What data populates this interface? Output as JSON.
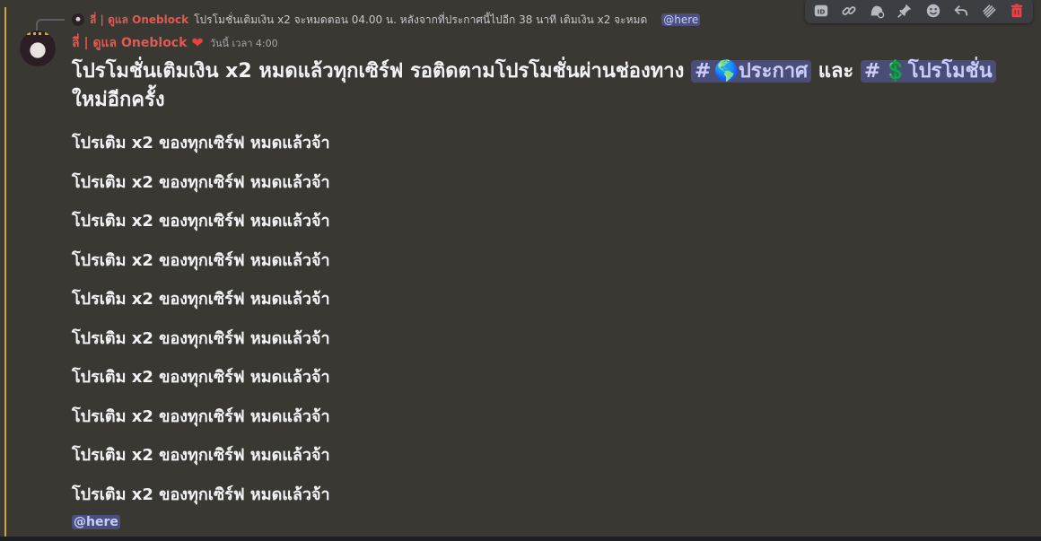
{
  "reply": {
    "author": "ลี่ | ดูแล Oneblock",
    "text": "โปรโมชั่นเติมเงิน x2 จะหมดตอน 04.00 น.    หลังจากที่ประกาศนี้ไปอีก 38 นาที เติมเงิน x2 จะหมด",
    "mention": "@here"
  },
  "message": {
    "author": "ลี่ | ดูแล Oneblock",
    "timestamp": "วันนี้ เวลา 4:00",
    "headline_part1": "โปรโมชั่นเติมเงิน x2 หมดแล้วทุกเซิร์ฟ รอติดตามโปรโมชั่นผ่านช่องทาง",
    "channel1": "🌎ประกาศ",
    "and_word": "และ",
    "channel2": "💲โปรโมชั่น",
    "headline_part2": "ใหม่อีกครั้ง",
    "lines": [
      "โปรเติม x2 ของทุกเซิร์ฟ หมดแล้วจ้า",
      "โปรเติม x2 ของทุกเซิร์ฟ หมดแล้วจ้า",
      "โปรเติม x2 ของทุกเซิร์ฟ หมดแล้วจ้า",
      "โปรเติม x2 ของทุกเซิร์ฟ หมดแล้วจ้า",
      "โปรเติม x2 ของทุกเซิร์ฟ หมดแล้วจ้า",
      "โปรเติม x2 ของทุกเซิร์ฟ หมดแล้วจ้า",
      "โปรเติม x2 ของทุกเซิร์ฟ หมดแล้วจ้า",
      "โปรเติม x2 ของทุกเซิร์ฟ หมดแล้วจ้า",
      "โปรเติม x2 ของทุกเซิร์ฟ หมดแล้วจ้า",
      "โปรเติม x2 ของทุกเซิร์ฟ หมดแล้วจ้า"
    ],
    "mention": "@here"
  },
  "toolbar": {
    "icons": [
      "id-icon",
      "link-icon",
      "thread-icon",
      "pin-icon",
      "emoji-icon",
      "reply-icon",
      "forward-icon",
      "delete-icon"
    ]
  },
  "colors": {
    "author": "#e05a52",
    "message_bg": "#3a3833",
    "highlight_bar": "#c9a63a",
    "mention_bg": "#4a4f80",
    "mention_text": "#c9cdfb",
    "delete": "#ed4245"
  }
}
